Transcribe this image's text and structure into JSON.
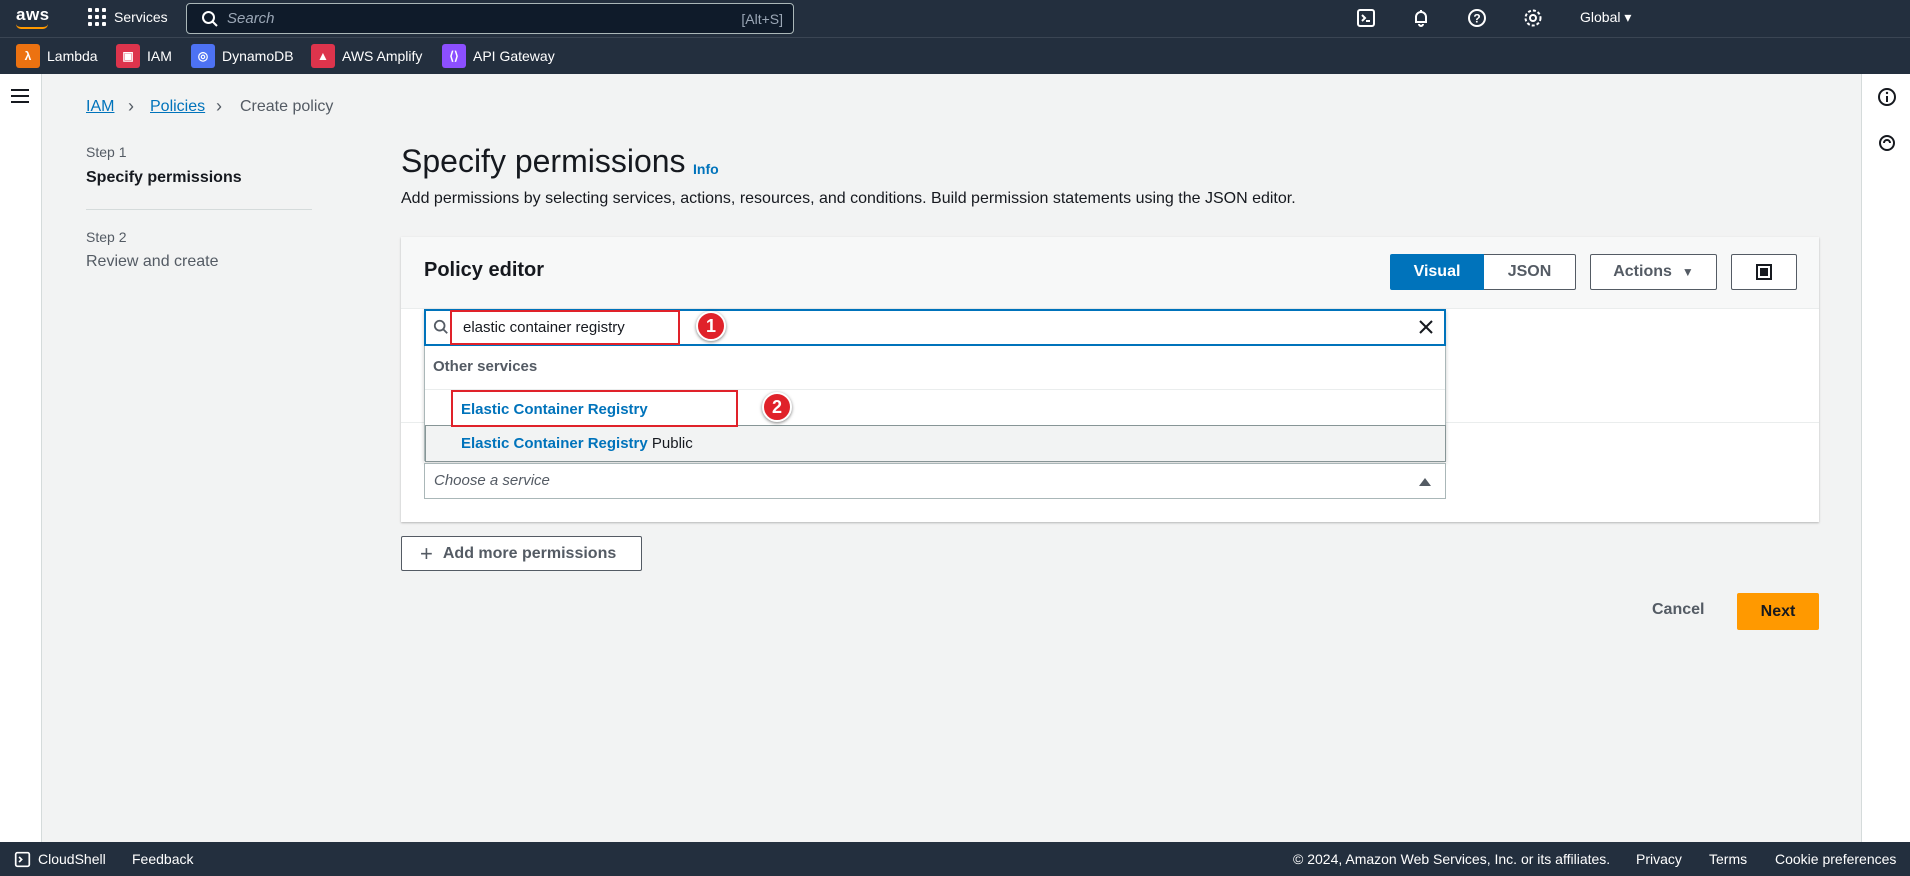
{
  "topnav": {
    "services_label": "Services",
    "search_placeholder": "Search",
    "search_shortcut": "[Alt+S]",
    "region": "Global",
    "logo": "aws"
  },
  "favorites": [
    {
      "label": "Lambda",
      "color": "#ec7211",
      "icon": "lambda-icon"
    },
    {
      "label": "IAM",
      "color": "#dd344c",
      "icon": "iam-icon"
    },
    {
      "label": "DynamoDB",
      "color": "#4d72f3",
      "icon": "dynamodb-icon"
    },
    {
      "label": "AWS Amplify",
      "color": "#dd344c",
      "icon": "amplify-icon"
    },
    {
      "label": "API Gateway",
      "color": "#8c4fff",
      "icon": "api-gateway-icon"
    }
  ],
  "breadcrumb": {
    "items": [
      "IAM",
      "Policies",
      "Create policy"
    ]
  },
  "steps": [
    {
      "step": "Step 1",
      "label": "Specify permissions"
    },
    {
      "step": "Step 2",
      "label": "Review and create"
    }
  ],
  "page": {
    "title": "Specify permissions",
    "info": "Info",
    "description": "Add permissions by selecting services, actions, resources, and conditions. Build permission statements using the JSON editor."
  },
  "editor": {
    "title": "Policy editor",
    "visual": "Visual",
    "json": "JSON",
    "actions": "Actions"
  },
  "service_search": {
    "value": "elastic container registry",
    "group": "Other services",
    "options": [
      {
        "highlight": "Elastic Container Registry",
        "rest": ""
      },
      {
        "highlight": "Elastic Container Registry",
        "rest": " Public"
      }
    ],
    "choose_placeholder": "Choose a service"
  },
  "annotations": [
    "1",
    "2"
  ],
  "buttons": {
    "add_more": "Add more permissions",
    "cancel": "Cancel",
    "next": "Next"
  },
  "footer": {
    "cloudshell": "CloudShell",
    "feedback": "Feedback",
    "copyright": "© 2024, Amazon Web Services, Inc. or its affiliates.",
    "privacy": "Privacy",
    "terms": "Terms",
    "cookies": "Cookie preferences"
  },
  "colors": {
    "nav_bg": "#232f3e",
    "link": "#0073bb",
    "primary": "#ff9900",
    "annotation": "#e0222a"
  }
}
